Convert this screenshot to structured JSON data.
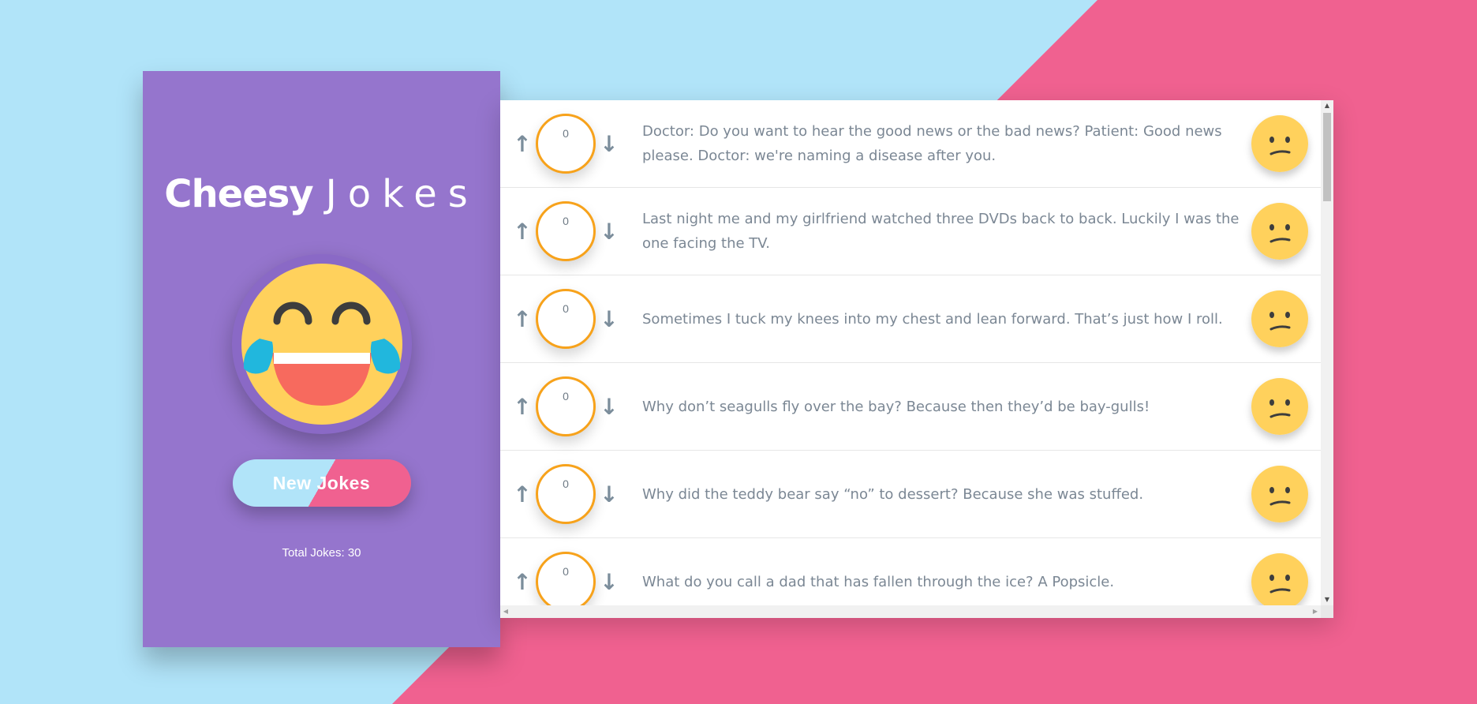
{
  "app": {
    "title_bold": "Cheesy",
    "title_light": "Jokes",
    "new_jokes_label": "New Jokes",
    "total_label": "Total Jokes: 30"
  },
  "colors": {
    "sidebar": "#9575cd",
    "bg_blue": "#b1e4f9",
    "bg_pink": "#f06190",
    "score_border": "#f7a21b",
    "emoji_yellow": "#ffd15c"
  },
  "icons": {
    "header_emoji": "laughing-with-tears-icon",
    "row_emoji": "confused-face-icon",
    "upvote": "arrow-up-icon",
    "downvote": "arrow-down-icon"
  },
  "jokes": [
    {
      "score": "0",
      "text": "Doctor: Do you want to hear the good news or the bad news? Patient: Good news please. Doctor: we're naming a disease after you."
    },
    {
      "score": "0",
      "text": "Last night me and my girlfriend watched three DVDs back to back. Luckily I was the one facing the TV."
    },
    {
      "score": "0",
      "text": "Sometimes I tuck my knees into my chest and lean forward. That’s just how I roll."
    },
    {
      "score": "0",
      "text": "Why don’t seagulls fly over the bay? Because then they’d be bay-gulls!"
    },
    {
      "score": "0",
      "text": "Why did the teddy bear say “no” to dessert? Because she was stuffed."
    },
    {
      "score": "0",
      "text": "What do you call a dad that has fallen through the ice? A Popsicle."
    }
  ]
}
